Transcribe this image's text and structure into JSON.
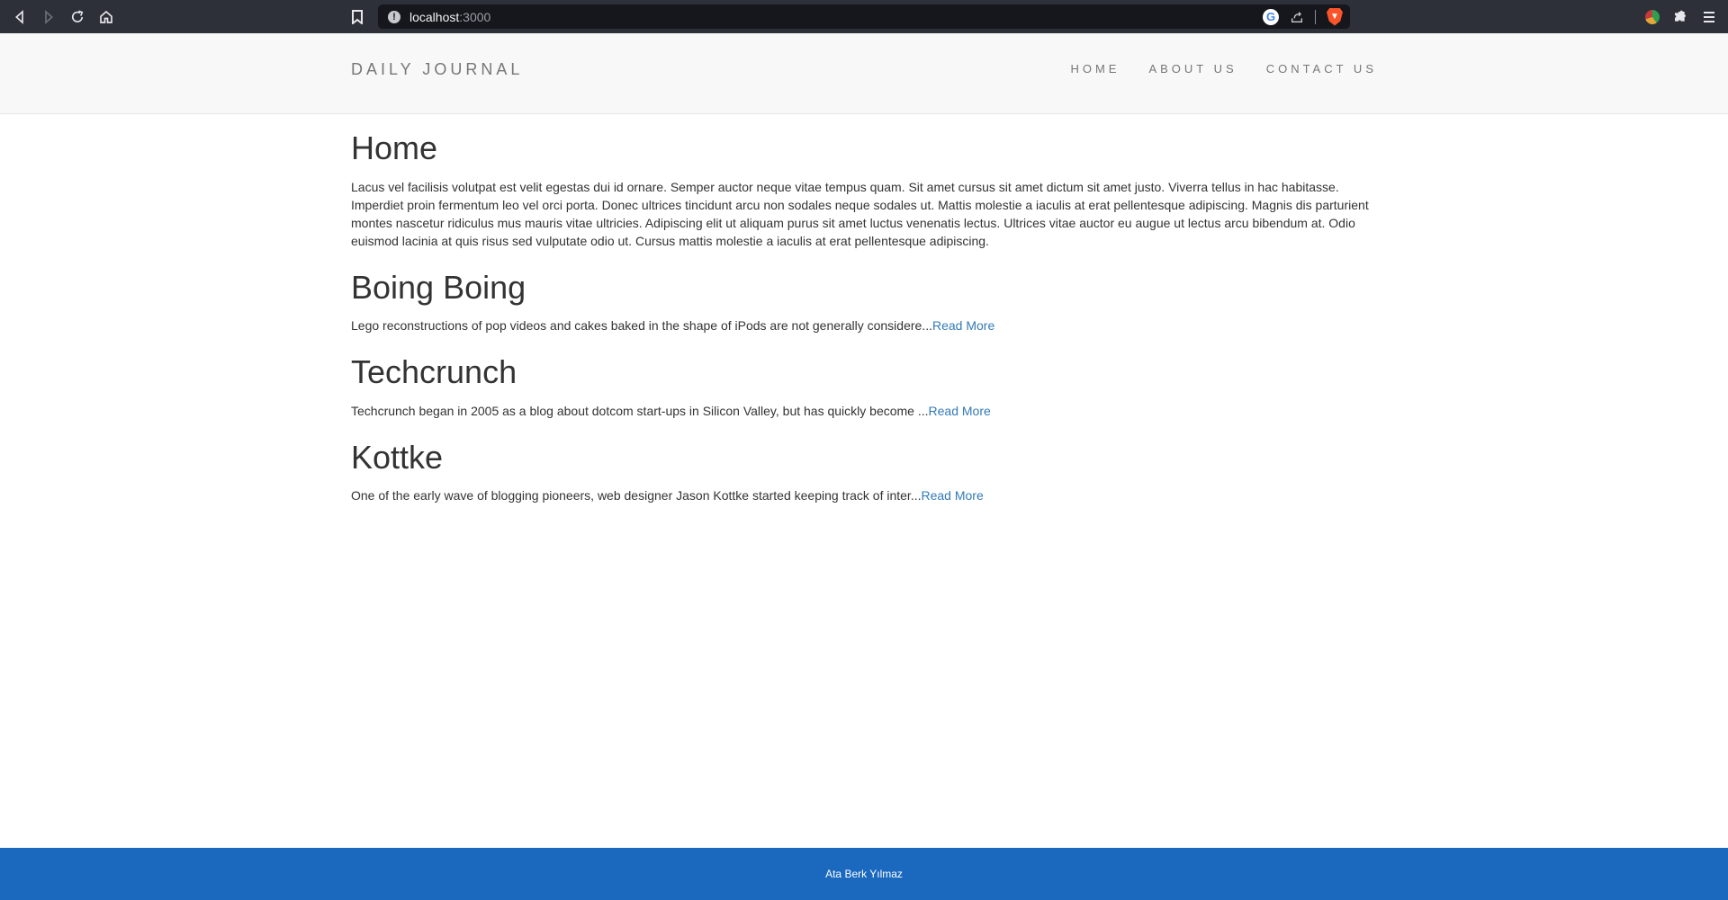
{
  "browser": {
    "url_host": "localhost",
    "url_port": ":3000",
    "info_glyph": "!",
    "search_engine_glyph": "G"
  },
  "site": {
    "brand": "DAILY JOURNAL",
    "nav": [
      "HOME",
      "ABOUT US",
      "CONTACT US"
    ]
  },
  "home": {
    "title": "Home",
    "text": "Lacus vel facilisis volutpat est velit egestas dui id ornare. Semper auctor neque vitae tempus quam. Sit amet cursus sit amet dictum sit amet justo. Viverra tellus in hac habitasse. Imperdiet proin fermentum leo vel orci porta. Donec ultrices tincidunt arcu non sodales neque sodales ut. Mattis molestie a iaculis at erat pellentesque adipiscing. Magnis dis parturient montes nascetur ridiculus mus mauris vitae ultricies. Adipiscing elit ut aliquam purus sit amet luctus venenatis lectus. Ultrices vitae auctor eu augue ut lectus arcu bibendum at. Odio euismod lacinia at quis risus sed vulputate odio ut. Cursus mattis molestie a iaculis at erat pellentesque adipiscing."
  },
  "posts": [
    {
      "title": "Boing Boing",
      "excerpt": "Lego reconstructions of pop videos and cakes baked in the shape of iPods are not generally considere...",
      "link": "Read More"
    },
    {
      "title": "Techcrunch",
      "excerpt": "Techcrunch began in 2005 as a blog about dotcom start-ups in Silicon Valley, but has quickly become ...",
      "link": "Read More"
    },
    {
      "title": "Kottke",
      "excerpt": "One of the early wave of blogging pioneers, web designer Jason Kottke started keeping track of inter...",
      "link": "Read More"
    }
  ],
  "footer": {
    "text": "Ata Berk Yılmaz"
  },
  "colors": {
    "footer_bg": "#1b69bf",
    "link": "#337ab7",
    "header_bg": "#f8f8f8",
    "chrome_bg": "#2d3039"
  }
}
